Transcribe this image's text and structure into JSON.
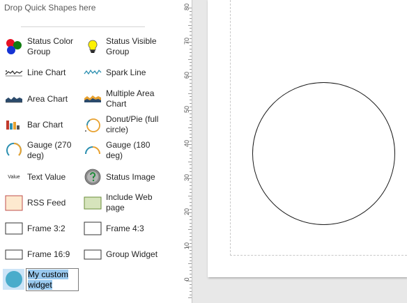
{
  "shapes_panel": {
    "drop_hint": "Drop Quick Shapes here",
    "items": [
      {
        "label": "Status Color Group",
        "icon": "status-color-group-icon"
      },
      {
        "label": "Status Visible Group",
        "icon": "lightbulb-icon"
      },
      {
        "label": "Line Chart",
        "icon": "line-chart-icon"
      },
      {
        "label": "Spark Line",
        "icon": "spark-line-icon"
      },
      {
        "label": "Area Chart",
        "icon": "area-chart-icon"
      },
      {
        "label": "Multiple Area Chart",
        "icon": "multiple-area-chart-icon"
      },
      {
        "label": "Bar Chart",
        "icon": "bar-chart-icon"
      },
      {
        "label": "Donut/Pie (full circle)",
        "icon": "donut-pie-icon"
      },
      {
        "label": "Gauge (270 deg)",
        "icon": "gauge-270-icon"
      },
      {
        "label": "Gauge (180 deg)",
        "icon": "gauge-180-icon"
      },
      {
        "label": "Text Value",
        "icon": "text-value-icon",
        "icon_text": "Value"
      },
      {
        "label": "Status Image",
        "icon": "status-image-icon"
      },
      {
        "label": "RSS Feed",
        "icon": "rss-feed-icon"
      },
      {
        "label": "Include Web page",
        "icon": "web-page-icon"
      },
      {
        "label": "Frame 3:2",
        "icon": "frame-3-2-icon"
      },
      {
        "label": "Frame 4:3",
        "icon": "frame-4-3-icon"
      },
      {
        "label": "Frame 16:9",
        "icon": "frame-16-9-icon"
      },
      {
        "label": "Group Widget",
        "icon": "group-widget-icon"
      }
    ],
    "custom_item": {
      "label": "My custom widget",
      "icon": "custom-widget-circle-icon",
      "state": "renaming"
    }
  },
  "ruler": {
    "labels": [
      "80",
      "70",
      "60",
      "50",
      "40",
      "30",
      "20",
      "10",
      "0"
    ]
  },
  "canvas": {
    "shapes": [
      {
        "type": "circle",
        "name": "circle-shape"
      }
    ]
  },
  "colors": {
    "selection": "#cce4f7",
    "text_selection": "#99c9ef",
    "canvas_background": "#e8e8e8",
    "custom_circle_fill": "#4aaccb"
  }
}
